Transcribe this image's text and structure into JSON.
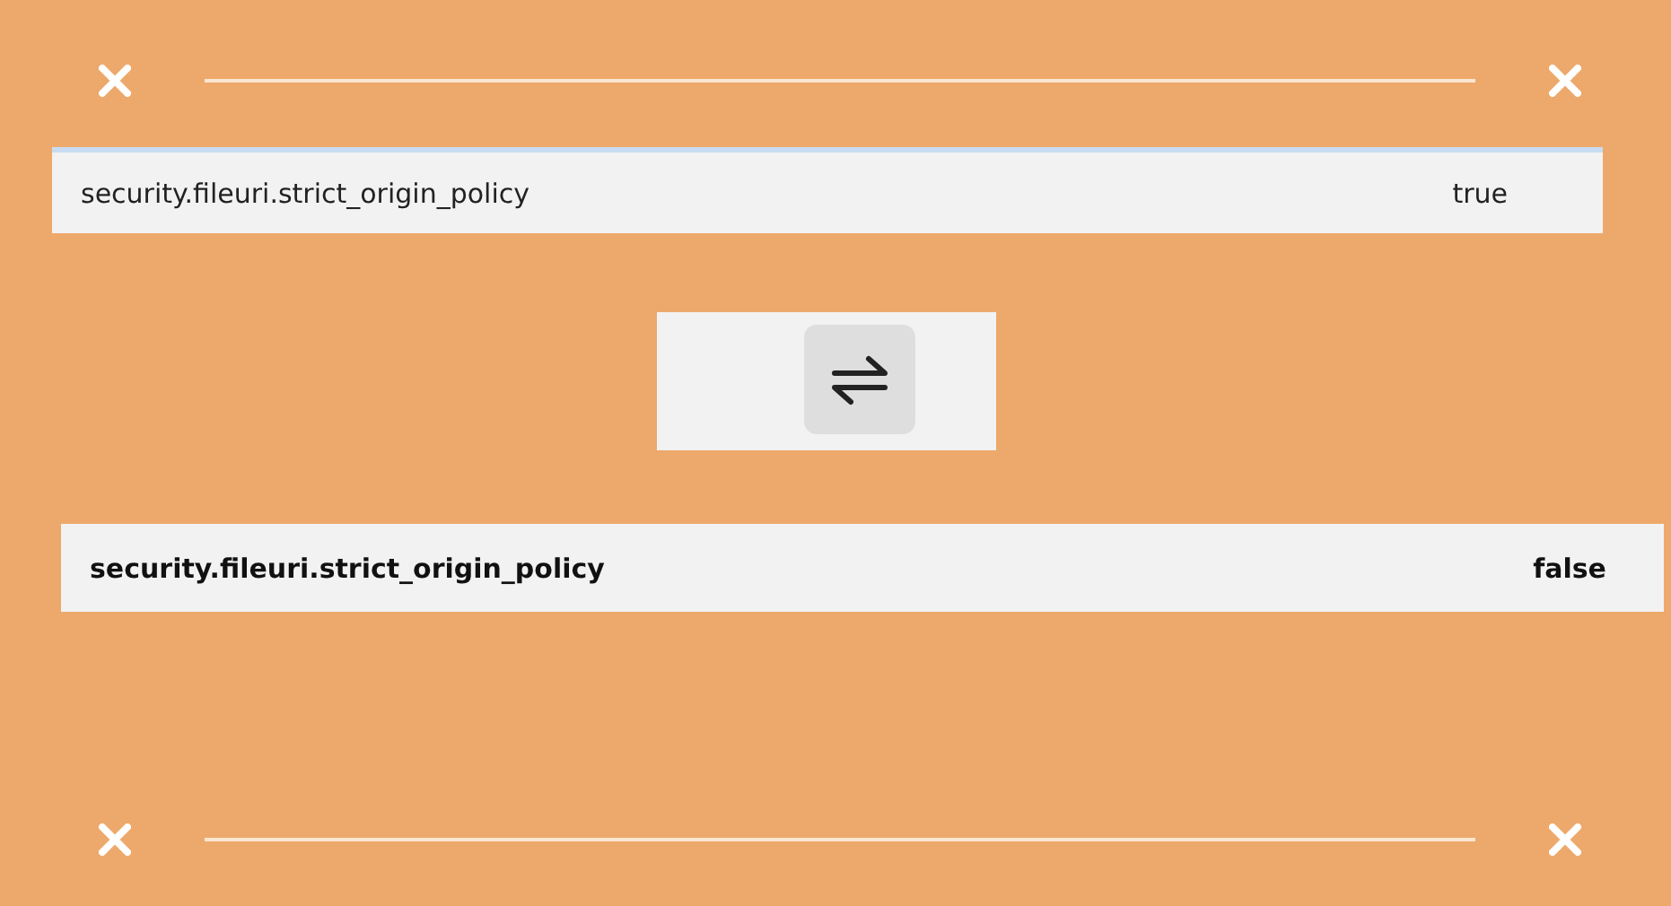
{
  "prefs": [
    {
      "name": "security.fileuri.strict_origin_policy",
      "value": "true",
      "modified": false,
      "focused": true
    },
    {
      "name": "security.fileuri.strict_origin_policy",
      "value": "false",
      "modified": true,
      "focused": false
    }
  ]
}
